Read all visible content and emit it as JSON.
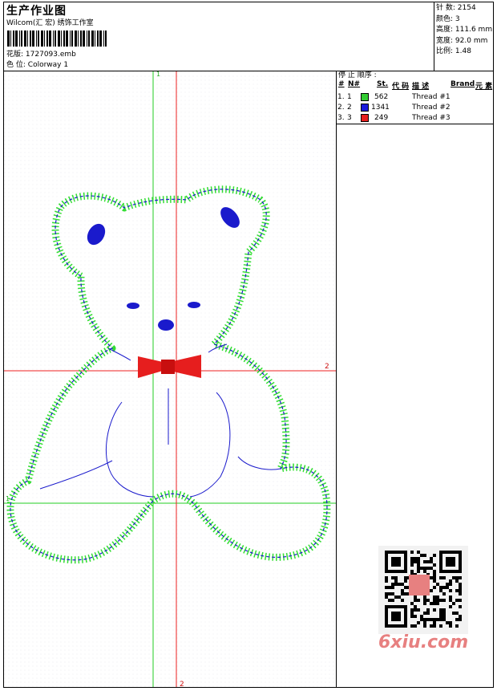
{
  "header": {
    "title": "生产作业图",
    "software": "Wilcom(汇 宏) 绣饰工作室",
    "design_label": "花版:",
    "design_file": "1727093.emb",
    "colorway_label": "色 位:",
    "colorway": "Colorway 1"
  },
  "stats": {
    "stitches_label": "针 数:",
    "stitches": "2154",
    "colors_label": "颜色:",
    "colors": "3",
    "height_label": "高度:",
    "height": "111.6 mm",
    "width_label": "宽度:",
    "width": "92.0 mm",
    "scale_label": "比例:",
    "scale": "1.48"
  },
  "stop_sequence": {
    "title": "停 止 顺序 :",
    "columns": [
      "#",
      "N#",
      "St.",
      "代 码",
      "描 述",
      "Brand",
      "元 素"
    ],
    "rows": [
      {
        "index": "1.",
        "n": "1",
        "stitches": "562",
        "color": "#33cc33",
        "description": "Thread #1"
      },
      {
        "index": "2.",
        "n": "2",
        "stitches": "1341",
        "color": "#1a1adb",
        "description": "Thread #2"
      },
      {
        "index": "3.",
        "n": "3",
        "stitches": "249",
        "color": "#e61e1e",
        "description": "Thread #3"
      }
    ]
  },
  "guides": {
    "green_vertical_label": "1",
    "green_horizontal_label": "1",
    "red_vertical_label": "2",
    "red_horizontal_label": "2"
  },
  "colors": {
    "outline_green": "#33dd33",
    "outline_blue": "#1a1acc",
    "bow_red": "#e61e1e",
    "guide_green": "#22cc22",
    "guide_red": "#ee2222",
    "watermark": "#e78080"
  },
  "watermark": {
    "text": "6xiu.com",
    "qr_icon": "qr-code-icon"
  }
}
